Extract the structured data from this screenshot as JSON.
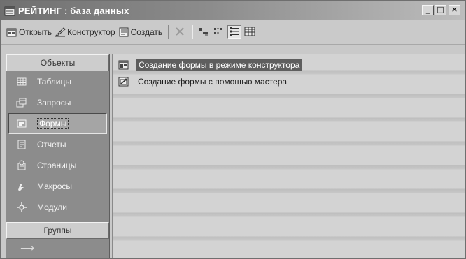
{
  "window": {
    "title": "РЕЙТИНГ : база данных",
    "controls": {
      "minimize": "_",
      "maximize": "□",
      "close": "×"
    }
  },
  "toolbar": {
    "open_label": "Открыть",
    "design_label": "Конструктор",
    "create_label": "Создать",
    "icons": [
      "delete-icon",
      "large-icons-icon",
      "small-icons-icon",
      "list-view-icon",
      "details-view-icon"
    ]
  },
  "sidebar": {
    "header": "Объекты",
    "items": [
      {
        "label": "Таблицы",
        "icon": "table-icon",
        "selected": false
      },
      {
        "label": "Запросы",
        "icon": "query-icon",
        "selected": false
      },
      {
        "label": "Формы",
        "icon": "form-icon",
        "selected": true
      },
      {
        "label": "Отчеты",
        "icon": "report-icon",
        "selected": false
      },
      {
        "label": "Страницы",
        "icon": "page-icon",
        "selected": false
      },
      {
        "label": "Макросы",
        "icon": "macro-icon",
        "selected": false
      },
      {
        "label": "Модули",
        "icon": "module-icon",
        "selected": false
      }
    ],
    "groups_label": "Группы"
  },
  "main": {
    "items": [
      {
        "label": "Создание формы в режиме конструктора",
        "icon": "design-form-icon",
        "selected": true
      },
      {
        "label": "Создание формы с помощью мастера",
        "icon": "wizard-form-icon",
        "selected": false
      }
    ]
  }
}
